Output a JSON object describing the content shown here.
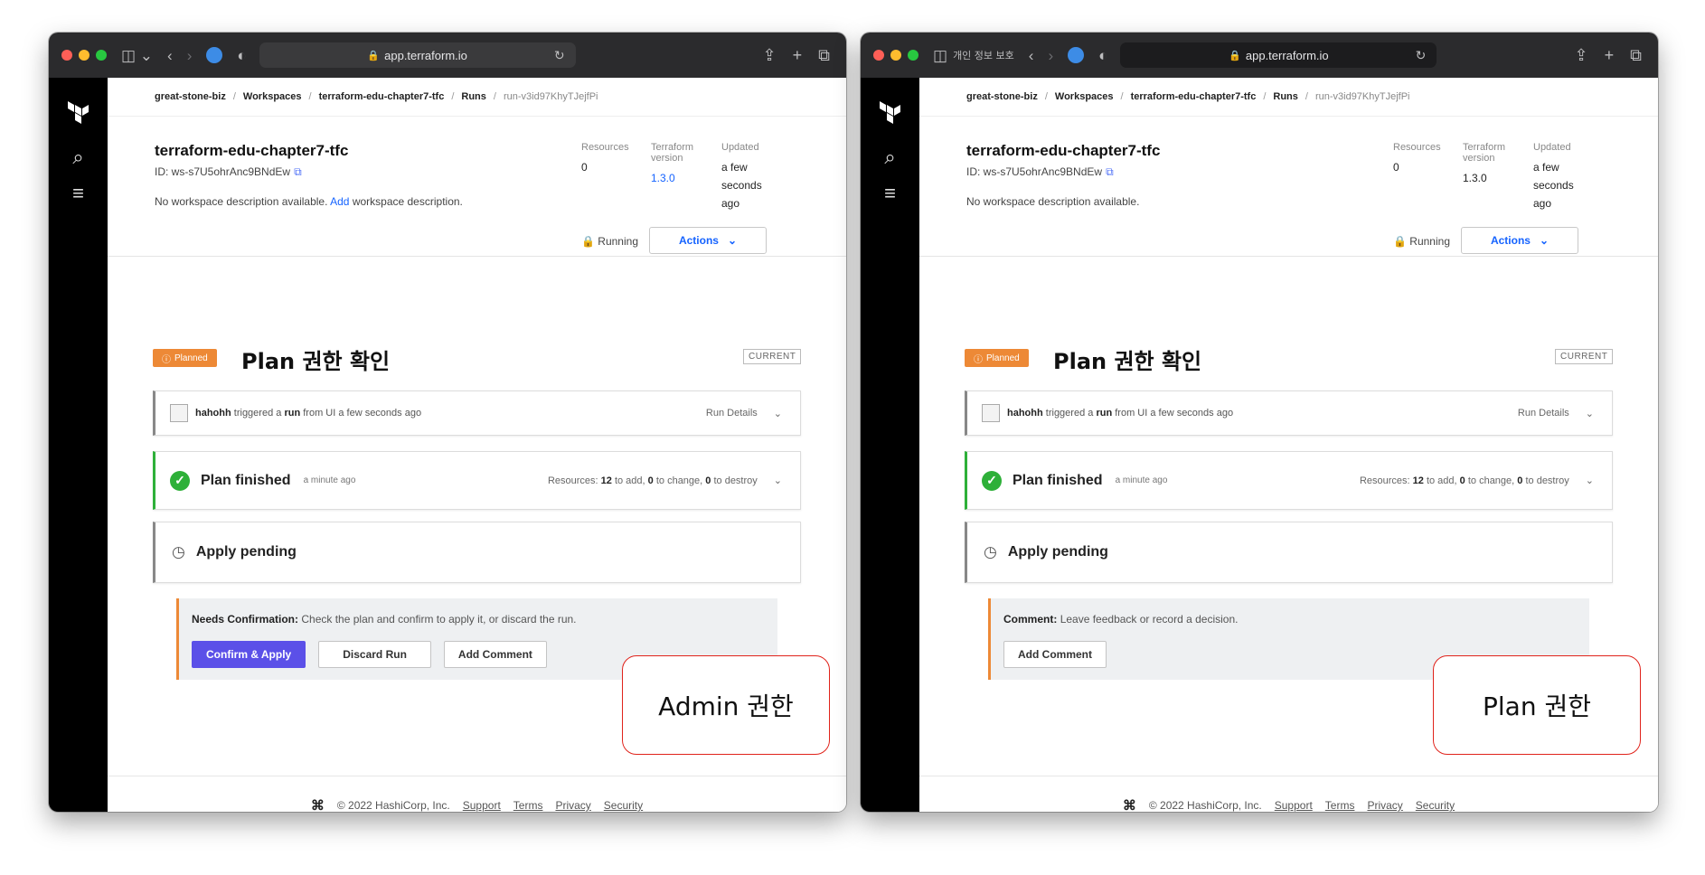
{
  "left": {
    "browser": {
      "tab_label": "",
      "url": "app.terraform.io"
    },
    "breadcrumbs": [
      "great-stone-biz",
      "Workspaces",
      "terraform-edu-chapter7-tfc",
      "Runs",
      "run-v3id97KhyTJejfPi"
    ],
    "workspace": {
      "name": "terraform-edu-chapter7-tfc",
      "id": "ID: ws-s7U5ohrAnc9BNdEw",
      "description": "No workspace description available.",
      "add_link": "Add",
      "add_suffix": "workspace description."
    },
    "meta": {
      "resources_label": "Resources",
      "resources_value": "0",
      "terraform_label_1": "Terraform",
      "terraform_label_2": "version",
      "terraform_value": "1.3.0",
      "updated_label": "Updated",
      "updated_1": "a few",
      "updated_2": "seconds",
      "updated_3": "ago"
    },
    "status": {
      "running": "Running",
      "actions": "Actions"
    },
    "run": {
      "badge": "Planned",
      "title": "Plan 권한 확인",
      "current": "CURRENT"
    },
    "trigger": {
      "user": "hahohh",
      "text_1": "triggered a",
      "run_word": "run",
      "text_2": "from UI a few seconds ago",
      "details": "Run Details"
    },
    "plan": {
      "title": "Plan finished",
      "time": "a minute ago",
      "res_prefix": "Resources:",
      "add_n": "12",
      "add_text": "to add,",
      "change_n": "0",
      "change_text": "to change,",
      "destroy_n": "0",
      "destroy_text": "to destroy"
    },
    "apply": {
      "title": "Apply pending"
    },
    "confirm": {
      "label": "Needs Confirmation:",
      "text": "Check the plan and confirm to apply it, or discard the run.",
      "buttons": [
        "Confirm & Apply",
        "Discard Run",
        "Add Comment"
      ]
    },
    "footer": {
      "copyright": "© 2022 HashiCorp, Inc.",
      "links": [
        "Support",
        "Terms",
        "Privacy",
        "Security"
      ]
    },
    "callout": "Admin 권한"
  },
  "right": {
    "browser": {
      "tab_label": "개인 정보 보호",
      "url": "app.terraform.io"
    },
    "breadcrumbs": [
      "great-stone-biz",
      "Workspaces",
      "terraform-edu-chapter7-tfc",
      "Runs",
      "run-v3id97KhyTJejfPi"
    ],
    "workspace": {
      "name": "terraform-edu-chapter7-tfc",
      "id": "ID: ws-s7U5ohrAnc9BNdEw",
      "description": "No workspace description available."
    },
    "meta": {
      "resources_label": "Resources",
      "resources_value": "0",
      "terraform_label_1": "Terraform",
      "terraform_label_2": "version",
      "terraform_value": "1.3.0",
      "updated_label": "Updated",
      "updated_1": "a few",
      "updated_2": "seconds",
      "updated_3": "ago"
    },
    "status": {
      "running": "Running",
      "actions": "Actions"
    },
    "run": {
      "badge": "Planned",
      "title": "Plan 권한 확인",
      "current": "CURRENT"
    },
    "trigger": {
      "user": "hahohh",
      "text_1": "triggered a",
      "run_word": "run",
      "text_2": "from UI a few seconds ago",
      "details": "Run Details"
    },
    "plan": {
      "title": "Plan finished",
      "time": "a minute ago",
      "res_prefix": "Resources:",
      "add_n": "12",
      "add_text": "to add,",
      "change_n": "0",
      "change_text": "to change,",
      "destroy_n": "0",
      "destroy_text": "to destroy"
    },
    "apply": {
      "title": "Apply pending"
    },
    "confirm": {
      "label": "Comment:",
      "text": "Leave feedback or record a decision.",
      "buttons": [
        "Add Comment"
      ]
    },
    "footer": {
      "copyright": "© 2022 HashiCorp, Inc.",
      "links": [
        "Support",
        "Terms",
        "Privacy",
        "Security"
      ]
    },
    "callout": "Plan 권한"
  }
}
